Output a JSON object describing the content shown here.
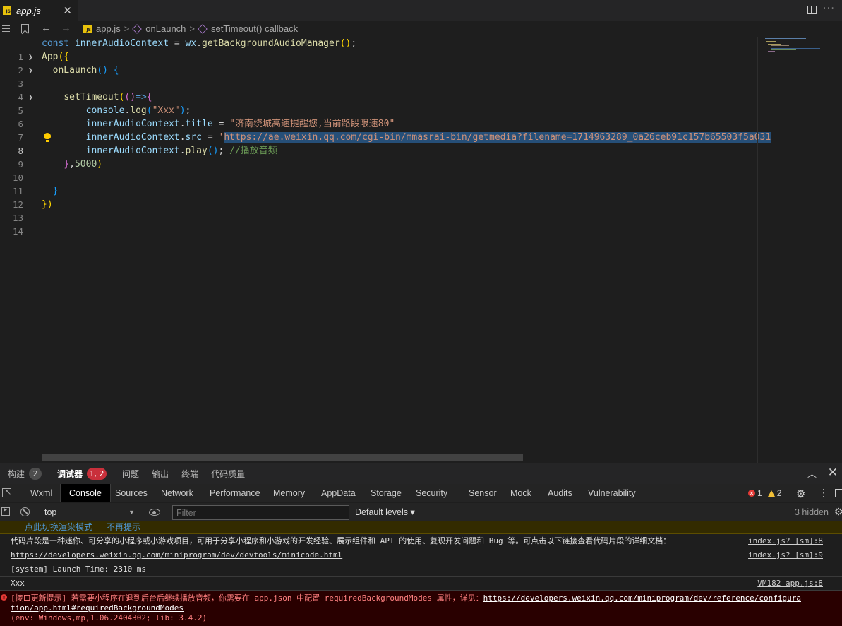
{
  "tab": {
    "title": "app.js",
    "badge": "JS"
  },
  "breadcrumb": {
    "file": "app.js",
    "method": "onLaunch",
    "callback": "setTimeout() callback",
    "sep": ">"
  },
  "editor": {
    "line_numbers": [
      "1",
      "2",
      "3",
      "4",
      "5",
      "6",
      "7",
      "8",
      "9",
      "10",
      "11",
      "12",
      "13",
      "14"
    ],
    "active_line": "8",
    "lines": {
      "l1": {
        "kw": "const",
        "var": " innerAudioContext",
        "op": " = ",
        "obj": "wx",
        "dot": ".",
        "fn": "getBackgroundAudioManager",
        "paren": "()",
        "end": ";"
      },
      "l2": {
        "fn": "App",
        "open": "({"
      },
      "l3": {
        "indent": "  ",
        "fn": "onLaunch",
        "paren": "()",
        "brace": " {"
      },
      "l5": {
        "indent": "    ",
        "fn": "setTimeout",
        "p1": "(",
        "p2": "()",
        "arrow": "=>",
        "brace": "{"
      },
      "l6": {
        "indent": "        ",
        "obj": "console",
        "dot": ".",
        "fn": "log",
        "p1": "(",
        "str": "\"Xxx\"",
        "p2": ")",
        "end": ";"
      },
      "l7": {
        "indent": "        ",
        "obj": "innerAudioContext",
        "dot": ".",
        "prop": "title",
        "op": " = ",
        "str": "\"济南绕城高速提醒您,当前路段限速80\""
      },
      "l8": {
        "indent": "        ",
        "obj": "innerAudioContext",
        "dot": ".",
        "prop": "src",
        "op": " = ",
        "q": "'",
        "url": "https://ae.weixin.qq.com/cgi-bin/mmasrai-bin/getmedia?filename=1714963289_0a26ceb91c157b65503f5a031"
      },
      "l9": {
        "indent": "        ",
        "obj": "innerAudioContext",
        "dot": ".",
        "fn": "play",
        "paren": "()",
        "end": "; ",
        "comment": "//播放音频"
      },
      "l10": {
        "indent": "    ",
        "brace": "}",
        "comma": ",",
        "num": "5000",
        "close": ")"
      },
      "l12": {
        "indent": "  ",
        "brace": "}"
      },
      "l13": {
        "brace": "})"
      }
    }
  },
  "panel": {
    "tabs": [
      {
        "label": "构建",
        "count": "2"
      },
      {
        "label": "调试器",
        "count": "1, 2"
      },
      {
        "label": "问题"
      },
      {
        "label": "输出"
      },
      {
        "label": "终端"
      },
      {
        "label": "代码质量"
      }
    ]
  },
  "devtools": {
    "tabs": [
      "Wxml",
      "Console",
      "Sources",
      "Network",
      "Performance",
      "Memory",
      "AppData",
      "Storage",
      "Security",
      "Sensor",
      "Mock",
      "Audits",
      "Vulnerability"
    ],
    "errors": "1",
    "warnings": "2",
    "context": "top",
    "filter_placeholder": "Filter",
    "levels": "Default levels",
    "hidden": "3 hidden"
  },
  "console": {
    "banner_link1": "点此切换渲染模式",
    "banner_link2": "不再提示",
    "rows": [
      {
        "msg": "代码片段是一种迷你、可分享的小程序或小游戏项目，可用于分享小程序和小游戏的开发经验、展示组件和 API 的使用、复现开发问题和 Bug 等。可点击以下链接查看代码片段的详细文档：",
        "src": "index.js? [sm]:8"
      },
      {
        "msg": "https://developers.weixin.qq.com/miniprogram/dev/devtools/minicode.html",
        "src": "index.js? [sm]:9"
      },
      {
        "msg": "[system] Launch Time: 2310 ms",
        "src": ""
      },
      {
        "msg": "Xxx",
        "src": "VM182 app.js:8"
      }
    ],
    "error": {
      "prefix": "[接口更新提示] 若需要小程序在退到后台后继续播放音频，你需要在 app.json 中配置 requiredBackgroundModes 属性，详见：",
      "url1": "https://developers.weixin.qq.com/miniprogram/dev/reference/configura",
      "url2": "tion/app.html#requiredBackgroundModes",
      "env": "(env: Windows,mp,1.06.2404302; lib: 3.4.2)"
    }
  },
  "colors": {
    "keyword": "#569cd6",
    "function": "#dcdcaa",
    "string": "#ce9178",
    "comment": "#6a9955",
    "number": "#b5cea8",
    "error_bg": "#290000",
    "badge_red": "#c9303b"
  }
}
